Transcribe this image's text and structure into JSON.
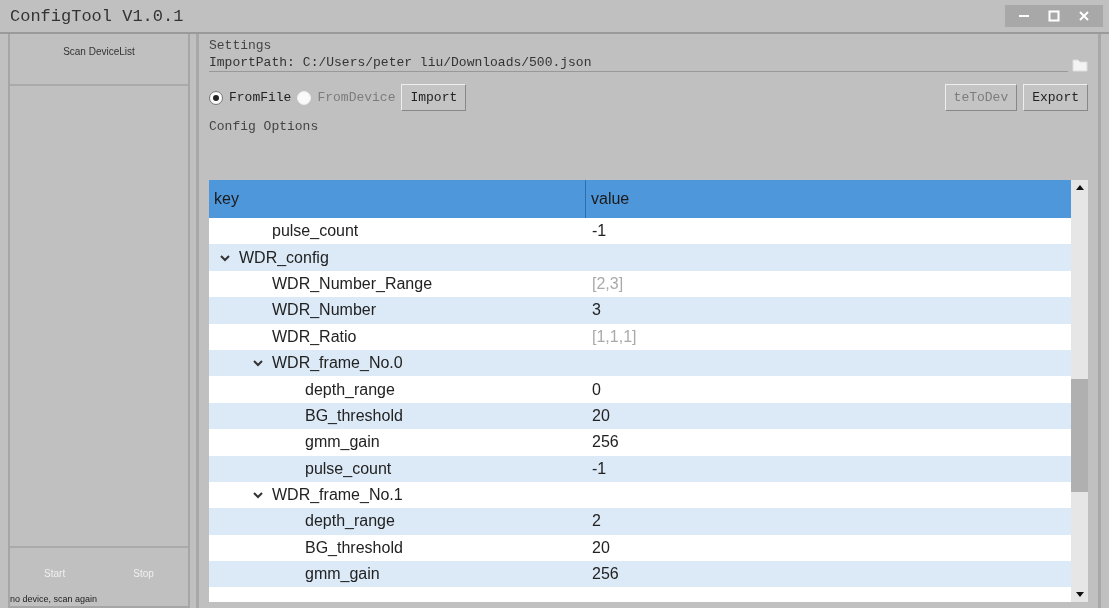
{
  "window": {
    "title": "ConfigTool V1.0.1"
  },
  "sidebar": {
    "scan_button": "Scan DeviceList",
    "start_button": {
      "label": "Start",
      "disabled": true
    },
    "stop_button": {
      "label": "Stop",
      "disabled": true
    },
    "status": "no device, scan again"
  },
  "settings": {
    "title": "Settings",
    "import_path": {
      "label": "ImportPath:",
      "value": "C:/Users/peter liu/Downloads/500.json"
    },
    "sources": [
      {
        "label": "FromFile",
        "selected": true,
        "disabled": false
      },
      {
        "label": "FromDevice",
        "selected": false,
        "disabled": true
      }
    ],
    "import_button": "Import",
    "write_button": {
      "label": "teToDev",
      "disabled": true
    },
    "export_button": "Export"
  },
  "config_options": {
    "title": "Config Options",
    "columns": [
      "key",
      "value"
    ],
    "tree": [
      {
        "children": [
          {
            "key": "pulse_count",
            "value": "-1",
            "read_only": false
          }
        ]
      },
      {
        "key": "WDR_config",
        "expanded": true,
        "children": [
          {
            "key": "WDR_Number_Range",
            "value": "[2,3]",
            "read_only": true
          },
          {
            "key": "WDR_Number",
            "value": "3",
            "read_only": false
          },
          {
            "key": "WDR_Ratio",
            "value": "[1,1,1]",
            "read_only": true
          },
          {
            "key": "WDR_frame_No.0",
            "expanded": true,
            "children": [
              {
                "key": "depth_range",
                "value": "0",
                "read_only": false
              },
              {
                "key": "BG_threshold",
                "value": "20",
                "read_only": false
              },
              {
                "key": "gmm_gain",
                "value": "256",
                "read_only": false
              },
              {
                "key": "pulse_count",
                "value": "-1",
                "read_only": false
              }
            ]
          },
          {
            "key": "WDR_frame_No.1",
            "expanded": true,
            "children": [
              {
                "key": "depth_range",
                "value": "2",
                "read_only": false
              },
              {
                "key": "BG_threshold",
                "value": "20",
                "read_only": false
              },
              {
                "key": "gmm_gain",
                "value": "256",
                "read_only": false
              }
            ]
          }
        ]
      }
    ]
  }
}
